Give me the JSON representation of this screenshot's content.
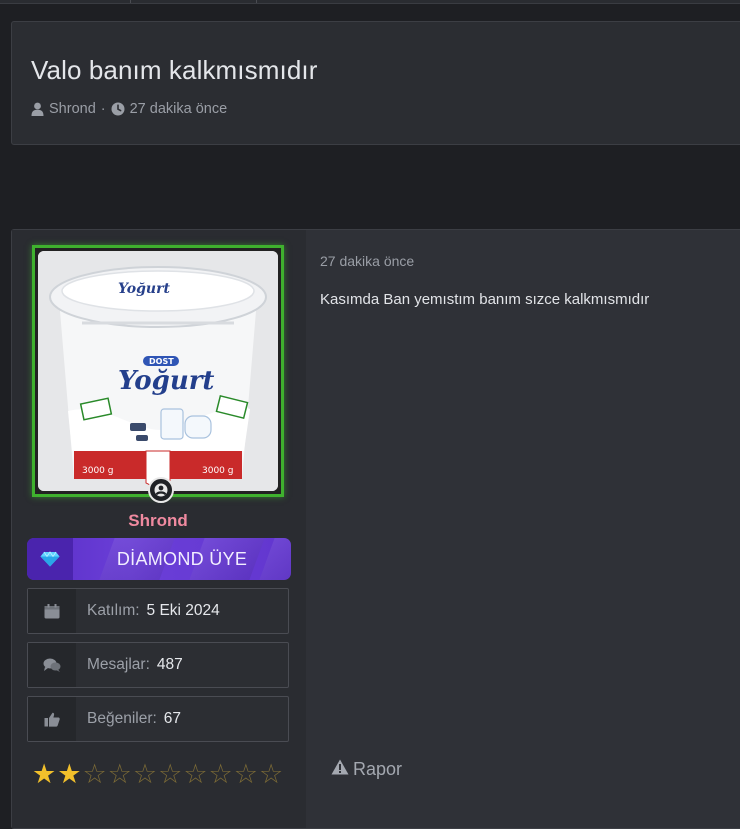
{
  "thread": {
    "title": "Valo banım kalkmısmıdır",
    "author": "Shrond",
    "separator": "·",
    "time_ago": "27 dakika önce"
  },
  "post": {
    "date": "27 dakika önce",
    "text": "Kasımda Ban yemıstım banım sızce kalkmısmıdır",
    "report_label": "Rapor",
    "user": {
      "name": "Shrond",
      "avatar": "yogurt-tub-image",
      "avatar_text": {
        "brand": "Yoğurt",
        "tag": "DOST",
        "weight": "3000 g"
      },
      "rank_label": "DİAMOND ÜYE",
      "rank_icon": "diamond-icon",
      "stats": [
        {
          "label": "Katılım:",
          "value": "5 Eki 2024",
          "icon": "calendar-icon"
        },
        {
          "label": "Mesajlar:",
          "value": "487",
          "icon": "messages-icon"
        },
        {
          "label": "Beğeniler:",
          "value": "67",
          "icon": "thumbs-up-icon"
        }
      ],
      "rating": {
        "filled": 2,
        "total": 10
      }
    }
  },
  "colors": {
    "background": "#1e1f23",
    "panel": "#2b2d32",
    "accent_green": "#3fb12e",
    "username_pink": "#f08aa0",
    "diamond_purple": "#6236cf",
    "star_gold": "#f2c02b"
  }
}
